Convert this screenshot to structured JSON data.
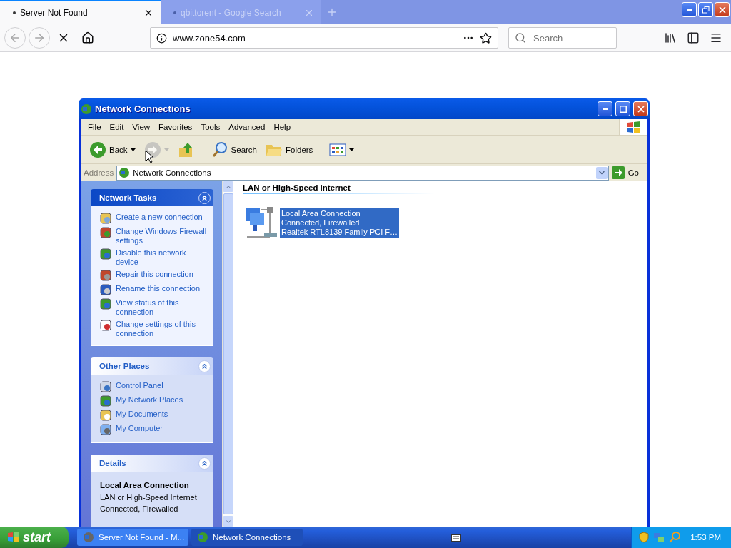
{
  "browser": {
    "tabs": [
      {
        "title": "Server Not Found",
        "selected": true
      },
      {
        "title": "qbittorent - Google Search",
        "selected": false
      }
    ],
    "url": "www.zone54.com",
    "search": {
      "placeholder": "Search"
    }
  },
  "window": {
    "title": "Network Connections",
    "menu": [
      "File",
      "Edit",
      "View",
      "Favorites",
      "Tools",
      "Advanced",
      "Help"
    ],
    "toolbar": [
      {
        "kind": "back",
        "label": "Back",
        "disabled": false
      },
      {
        "kind": "forward",
        "disabled": true
      },
      {
        "kind": "up",
        "disabled": false
      },
      {
        "kind": "search",
        "label": "Search",
        "disabled": false
      },
      {
        "kind": "folders",
        "label": "Folders",
        "disabled": false
      },
      {
        "kind": "views",
        "disabled": false
      }
    ],
    "address": {
      "label": "Address",
      "value": "Network Connections",
      "go": "Go"
    },
    "panels": [
      {
        "kind": "tasks",
        "title": "Network Tasks",
        "items": [
          "Create a new connection",
          "Change Windows Firewall settings",
          "Disable this network device",
          "Repair this connection",
          "Rename this connection",
          "View status of this connection",
          "Change settings of this connection"
        ]
      },
      {
        "kind": "places",
        "title": "Other Places",
        "items": [
          "Control Panel",
          "My Network Places",
          "My Documents",
          "My Computer"
        ]
      },
      {
        "kind": "details",
        "title": "Details",
        "name": "Local Area Connection",
        "lines": [
          "LAN or High-Speed Internet",
          "Connected, Firewalled"
        ]
      }
    ],
    "group": "LAN or High-Speed Internet",
    "connections": [
      {
        "name": "Local Area Connection",
        "status": "Connected, Firewalled",
        "device": "Realtek RTL8139 Family PCI F…",
        "selected": true
      }
    ]
  },
  "taskbar": {
    "start": "start",
    "tasks": [
      {
        "label": "Server Not Found - M...",
        "selected": false
      },
      {
        "label": "Network Connections",
        "selected": true
      }
    ],
    "clock": "1:53 PM"
  }
}
